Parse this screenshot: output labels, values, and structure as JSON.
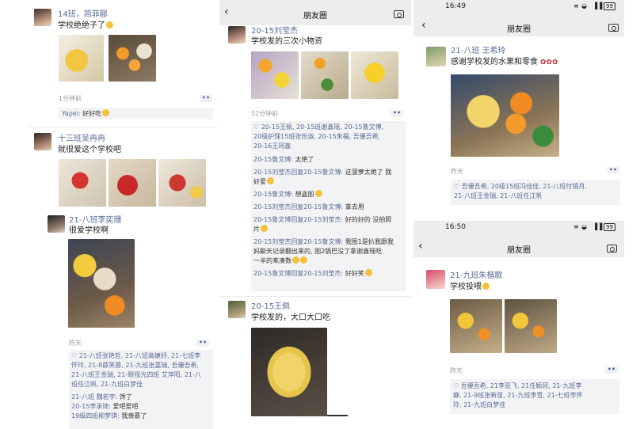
{
  "col1": {
    "post1": {
      "author": "14班，简菲郦",
      "text": "学校绝绝子了",
      "time": "1分钟前",
      "comment_user": "Yapei:",
      "comment_text": "好好吃"
    },
    "post2": {
      "author": "十三班吴冉冉",
      "text": "就很爱这个学校吧"
    },
    "post3": {
      "author": "21-八班李奕珊",
      "text": "很爱学校啊",
      "time": "昨天",
      "likes": [
        "♡ 21-八班张艳哲, 21-八班高婕妤, 21-七班李",
        "怀玲, 21-8薛芙蓉, 21-九班张嘉瑞, 吾優吾希,",
        "21-八班王金瑞, 21-眼视光四班 艾萍阳, 21-八",
        "班任江帆, 21-九班白梦佳"
      ],
      "comments": [
        {
          "u": "21-八班 魏若宇:",
          "t": "馋了"
        },
        {
          "u": "20-15李承琦:",
          "t": "爱吧爱吧"
        },
        {
          "u": "19级四班柳梦琪:",
          "t": "我羡慕了"
        }
      ]
    }
  },
  "col2": {
    "nav_title": "朋友圈",
    "post1": {
      "author": "20-15刘莹杰",
      "text": "学校发的三次小物资",
      "time": "52分钟前",
      "likes": [
        "♡ 20-15王佩, 20-15班谢鑫瑶, 20-15鲁文博,",
        "20级护理15班张怡淑, 20-15朱福, 吾優吾希,",
        "20-16王珂鑫"
      ],
      "comments": [
        {
          "u": "20-15鲁文博:",
          "t": "太绝了"
        },
        {
          "u": "20-15刘莹杰回复20-15鲁文博:",
          "t": "这菠萝太绝了 我"
        },
        {
          "u": "",
          "t": "好爱"
        },
        {
          "u": "20-15鲁文博:",
          "t": "想盗图"
        },
        {
          "u": "20-15刘莹杰回复20-15鲁文博:",
          "t": "拿去用"
        },
        {
          "u": "20-15鲁文博回复20-15刘莹杰:",
          "t": "好的好的 没拍照"
        },
        {
          "u": "",
          "t": "片"
        },
        {
          "u": "20-15刘莹杰回复20-15鲁文博:",
          "t": "我图1是扒我跟我"
        },
        {
          "u": "",
          "t": "妈聊天记录翻出来的, 图2锅巴没了拿谢鑫瑶吃"
        },
        {
          "u": "",
          "t": "一半的来凑数"
        },
        {
          "u": "20-15鲁文博回复20-15刘莹杰:",
          "t": "好好笑"
        }
      ]
    },
    "post2": {
      "author": "20-15王佩",
      "text": "学校发的，大口大口吃"
    }
  },
  "col3a": {
    "status_time": "16:49",
    "battery": "99",
    "nav_title": "朋友圈",
    "author": "21-八班 王希玲",
    "text": "感谢学校发的水果和零食",
    "time": "昨天",
    "likes": [
      "♡ 吾優吾希, 20级15班冯佳佳, 21-八班付镜月,",
      "21-八班王金瑞, 21-八班任江帆"
    ]
  },
  "col3b": {
    "status_time": "16:50",
    "battery": "99",
    "nav_title": "朋友圈",
    "author": "21-九班朱楷歌",
    "text": "学校投喂",
    "time": "昨天",
    "likes": [
      "♡ 吾優吾希, 21李亚飞, 21任颖珂, 21-九班李",
      "静, 21-9班张新苗, 21-九班李雪, 21-七班李怀",
      "玲, 21-九班白梦佳"
    ]
  },
  "colors": {
    "link": "#576b95",
    "panel": "#f3f3f5",
    "navbar": "#ededed"
  }
}
